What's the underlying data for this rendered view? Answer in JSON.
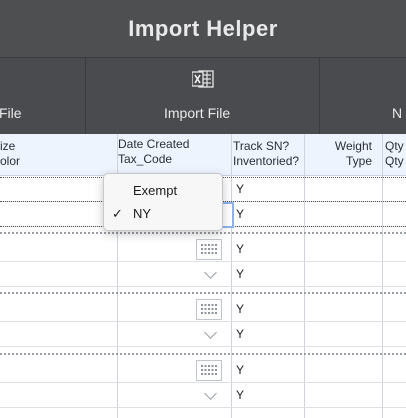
{
  "window": {
    "title": "Import Helper"
  },
  "toolbar": {
    "left_label": "File",
    "import_label": "Import File",
    "right_label": "N",
    "import_icon": "excel-icon"
  },
  "header": {
    "col1_line1": "ize",
    "col1_line2": "olor",
    "col2_line1": "Date Created",
    "col2_line2": "Tax_Code",
    "col3_line1": "Track SN?",
    "col3_line2": "Inventoried?",
    "col4_line1": "Weight",
    "col4_line2": "Type",
    "col5_line1": "Qty",
    "col5_line2": "Qty"
  },
  "rows": [
    {
      "track": "Y"
    },
    {
      "track": "Y"
    },
    {
      "track": "Y"
    },
    {
      "track": "Y"
    },
    {
      "track": "Y"
    },
    {
      "track": "Y"
    },
    {
      "track": "Y"
    },
    {
      "track": "Y"
    }
  ],
  "tax_code_dropdown": {
    "options": [
      "Exempt",
      "NY"
    ],
    "selected": "NY",
    "check_mark": "✓"
  },
  "colors": {
    "titlebar": "#4e4f51",
    "toolbar": "#4a4b4e",
    "header_bg": "#eef4fd",
    "focus": "#8bb4ee"
  }
}
